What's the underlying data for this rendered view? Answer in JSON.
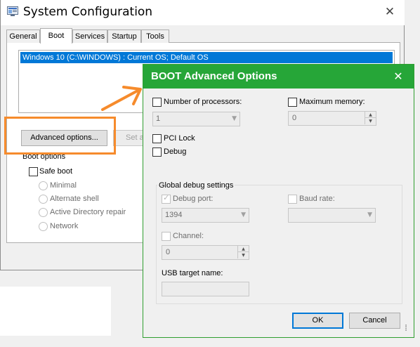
{
  "system_config": {
    "title": "System Configuration",
    "tabs": [
      {
        "label": "General",
        "active": false
      },
      {
        "label": "Boot",
        "active": true
      },
      {
        "label": "Services",
        "active": false
      },
      {
        "label": "Startup",
        "active": false
      },
      {
        "label": "Tools",
        "active": false
      }
    ],
    "os_list": {
      "selected_item": "Windows 10 (C:\\WINDOWS) : Current OS; Default OS"
    },
    "advanced_options_button": "Advanced options...",
    "set_as_default_button": "Set as",
    "boot_options_label": "Boot options",
    "safe_boot": {
      "label": "Safe boot",
      "checked": false
    },
    "safe_boot_modes": [
      "Minimal",
      "Alternate shell",
      "Active Directory repair",
      "Network"
    ]
  },
  "advanced_dialog": {
    "title": "BOOT Advanced Options",
    "number_of_processors": {
      "label": "Number of processors:",
      "checked": false,
      "value": "1"
    },
    "maximum_memory": {
      "label": "Maximum memory:",
      "checked": false,
      "value": "0"
    },
    "pci_lock": {
      "label": "PCI Lock",
      "checked": false
    },
    "debug": {
      "label": "Debug",
      "checked": false
    },
    "global_debug_settings": {
      "label": "Global debug settings",
      "debug_port": {
        "label": "Debug port:",
        "checked": true,
        "value": "1394"
      },
      "baud_rate": {
        "label": "Baud rate:",
        "checked": false,
        "value": ""
      },
      "channel": {
        "label": "Channel:",
        "checked": false,
        "value": "0"
      },
      "usb_target_name": {
        "label": "USB target name:",
        "value": ""
      }
    },
    "ok_button": "OK",
    "cancel_button": "Cancel"
  },
  "colors": {
    "dialog_titlebar": "#26a638",
    "annotation": "#f68b2c",
    "selection": "#0078d7"
  },
  "annotation": {
    "arrow": "arrow-icon",
    "highlight": "highlight-box"
  }
}
